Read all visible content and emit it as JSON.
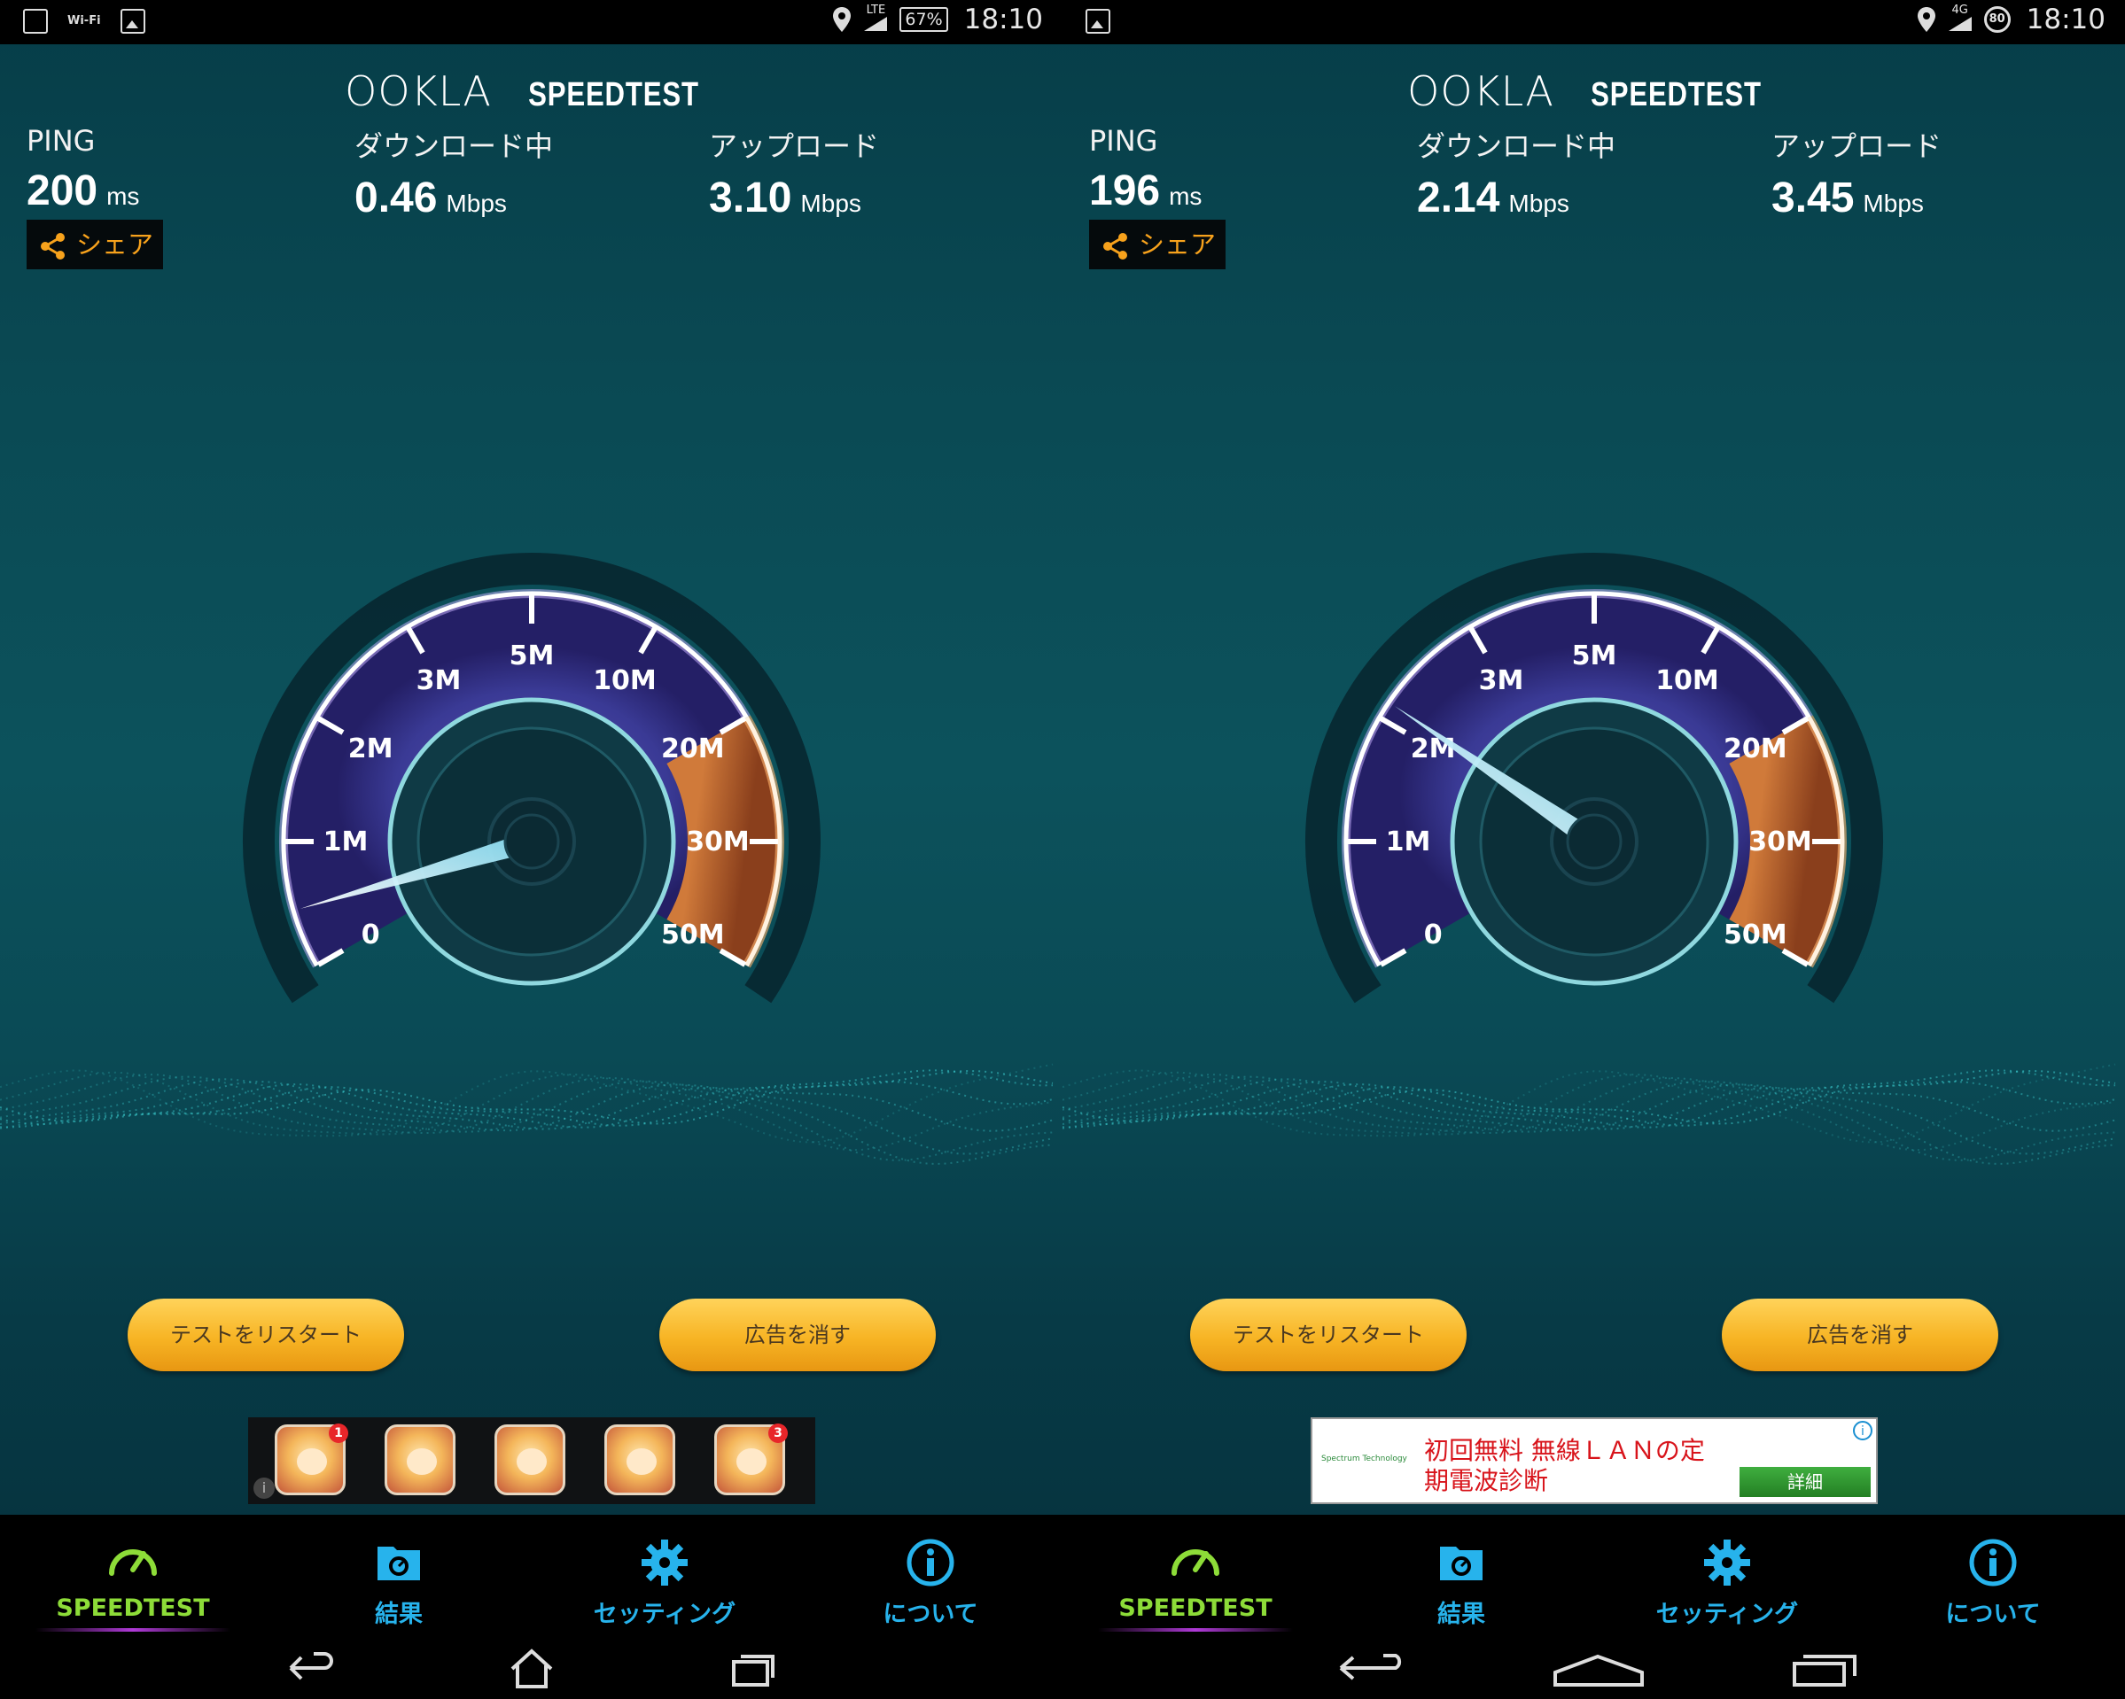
{
  "colors": {
    "accent_blue": "#27b3ec",
    "accent_green": "#8ddc38",
    "share_orange": "#f7a21c",
    "button_gold": "#f7b424",
    "ad_red": "#d8141b"
  },
  "gauge": {
    "ticks": [
      "0",
      "1M",
      "2M",
      "3M",
      "5M",
      "10M",
      "20M",
      "30M",
      "50M"
    ]
  },
  "labels": {
    "ping": "PING",
    "download": "ダウンロード中",
    "upload": "アップロード",
    "ms": "ms",
    "mbps": "Mbps",
    "share": "シェア",
    "restart": "テストをリスタート",
    "remove_ads": "広告を消す"
  },
  "logo": {
    "ookla": "OOKLA",
    "speedtest": "SPEEDTEST"
  },
  "nav": {
    "tabs": [
      {
        "label": "SPEEDTEST",
        "icon": "speedometer-icon"
      },
      {
        "label": "結果",
        "icon": "folder-results-icon"
      },
      {
        "label": "セッティング",
        "icon": "gear-icon"
      },
      {
        "label": "について",
        "icon": "info-icon"
      }
    ]
  },
  "panels": [
    {
      "status": {
        "network": "LTE",
        "battery": "67%",
        "time": "18:10",
        "left_icons": [
          "sim-icon",
          "wifi-icon",
          "image-icon"
        ]
      },
      "ping": "200",
      "download": "0.46",
      "upload": "3.10",
      "download_graph": [
        0.85,
        0.6,
        0.4,
        0.25,
        0.2,
        0.18,
        0.17,
        0.16,
        0.16,
        0.15,
        0.15,
        0.15,
        0.15,
        0.14,
        0.14,
        0.14,
        0.14,
        0.14,
        0.14,
        0.14,
        0.14,
        0.14,
        0.14,
        0.14,
        0.14,
        0.14,
        0.14,
        0.14,
        0.14,
        0.14,
        0.14,
        0.14,
        0.14,
        0.14,
        0.14,
        0.14,
        0.14,
        0.14,
        0.14,
        0.18
      ],
      "upload_graph": [
        0.9,
        0.75,
        0.7,
        0.6,
        0.55,
        0.5,
        0.5,
        0.52,
        0.5,
        0.48,
        0.5,
        0.5,
        0.52,
        0.5,
        0.5,
        0.5,
        0.5,
        0.52,
        0.5,
        0.5,
        0.5,
        0.5,
        0.5,
        0.5,
        0.5,
        0.5,
        0.52,
        0.5,
        0.5,
        0.5,
        0.5,
        0.5,
        0.5,
        0.5,
        0.5,
        0.5,
        0.5,
        0.52,
        0.55,
        0.6
      ],
      "needle_mbps": 0.46,
      "ad": {
        "type": "app-icons",
        "badges": [
          "1",
          "",
          "",
          "",
          "3"
        ]
      }
    },
    {
      "status": {
        "network": "4G",
        "battery": "80",
        "time": "18:10",
        "left_icons": [
          "image-icon"
        ]
      },
      "ping": "196",
      "download": "2.14",
      "upload": "3.45",
      "download_graph": [
        0.75,
        0.78,
        0.8,
        0.8,
        0.82,
        0.8,
        0.8,
        0.82,
        0.8,
        0.8,
        0.82,
        0.8,
        0.78,
        0.8,
        0.8,
        0.82,
        0.8,
        0.8,
        0.8,
        0.78,
        0.8,
        0.8,
        0.78,
        0.76,
        0.74,
        0.72,
        0.72,
        0.7,
        0.7,
        0.7,
        0.72,
        0.7,
        0.7,
        0.7,
        0.7,
        0.72,
        0.7,
        0.7,
        0.7,
        0.72
      ],
      "upload_graph": [
        0.9,
        0.78,
        0.7,
        0.62,
        0.58,
        0.55,
        0.55,
        0.55,
        0.55,
        0.52,
        0.55,
        0.55,
        0.55,
        0.55,
        0.55,
        0.55,
        0.55,
        0.55,
        0.55,
        0.55,
        0.55,
        0.55,
        0.55,
        0.55,
        0.55,
        0.55,
        0.55,
        0.55,
        0.55,
        0.55,
        0.55,
        0.55,
        0.55,
        0.55,
        0.55,
        0.55,
        0.55,
        0.55,
        0.55,
        0.58
      ],
      "needle_mbps": 2.14,
      "ad": {
        "type": "text",
        "logo": "Spectrum Technology",
        "line1": "初回無料 無線ＬＡＮの定",
        "line2": "期電波診断",
        "button": "詳細"
      }
    }
  ]
}
